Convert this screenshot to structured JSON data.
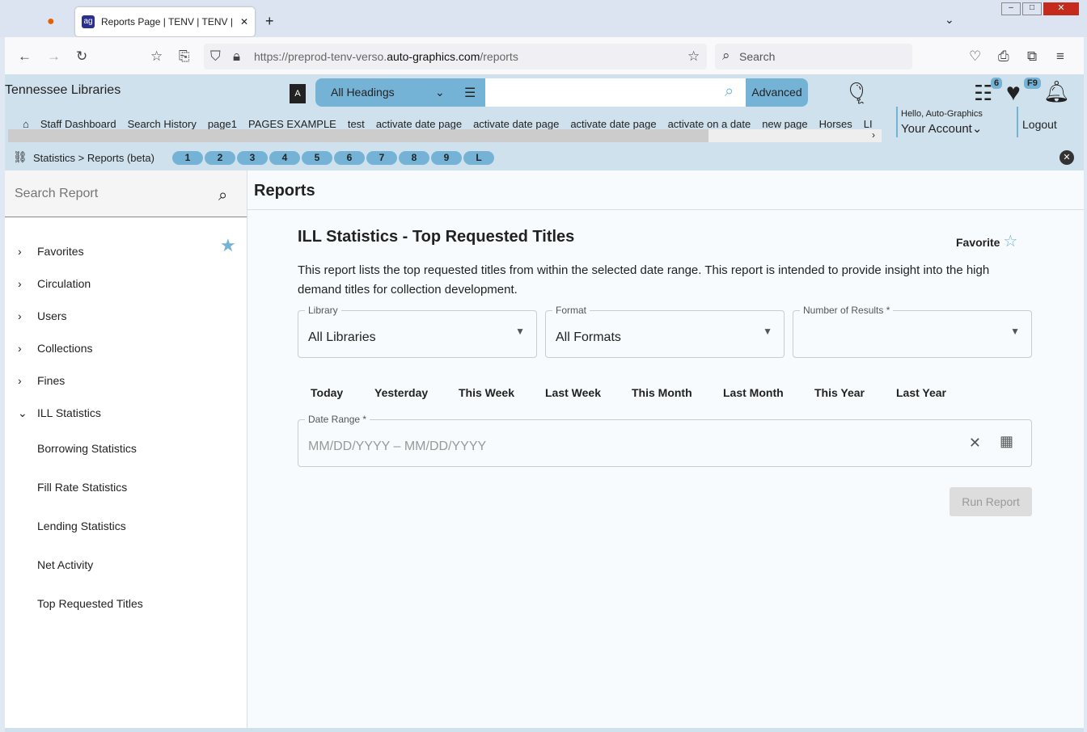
{
  "browser": {
    "tab_title": "Reports Page | TENV | TENV | Au",
    "url_prefix": "https://preprod-tenv-verso.",
    "url_domain": "auto-graphics.com",
    "url_path": "/reports",
    "search_placeholder": "Search"
  },
  "header": {
    "site_title": "Tennessee Libraries",
    "heading_select": "All Headings",
    "advanced_label": "Advanced",
    "list_badge": "6",
    "fav_badge": "F9",
    "greeting": "Hello, Auto-Graphics",
    "account_label": "Your Account",
    "logout_label": "Logout"
  },
  "links": [
    "Staff Dashboard",
    "Search History",
    "page1",
    "PAGES EXAMPLE",
    "test",
    "activate date page",
    "activate date page",
    "activate date page",
    "activate on a date",
    "new page",
    "Horses",
    "LI"
  ],
  "breadcrumb": {
    "text": "Statistics > Reports (beta)",
    "pages": [
      "1",
      "2",
      "3",
      "4",
      "5",
      "6",
      "7",
      "8",
      "9",
      "L"
    ]
  },
  "sidebar": {
    "search_placeholder": "Search Report",
    "groups": [
      "Favorites",
      "Circulation",
      "Users",
      "Collections",
      "Fines",
      "ILL Statistics"
    ],
    "ill_items": [
      "Borrowing Statistics",
      "Fill Rate Statistics",
      "Lending Statistics",
      "Net Activity",
      "Top Requested Titles"
    ]
  },
  "main": {
    "page_title": "Reports",
    "report_title": "ILL Statistics - Top Requested Titles",
    "favorite_label": "Favorite",
    "description": "This report lists the top requested titles from within the selected date range. This report is intended to provide insight into the high demand titles for collection development.",
    "library": {
      "label": "Library",
      "value": "All Libraries"
    },
    "format": {
      "label": "Format",
      "value": "All Formats"
    },
    "results": {
      "label": "Number of Results *",
      "value": ""
    },
    "quick_dates": [
      "Today",
      "Yesterday",
      "This Week",
      "Last Week",
      "This Month",
      "Last Month",
      "This Year",
      "Last Year"
    ],
    "date_range": {
      "label": "Date Range *",
      "placeholder": "MM/DD/YYYY – MM/DD/YYYY"
    },
    "run_label": "Run Report"
  }
}
